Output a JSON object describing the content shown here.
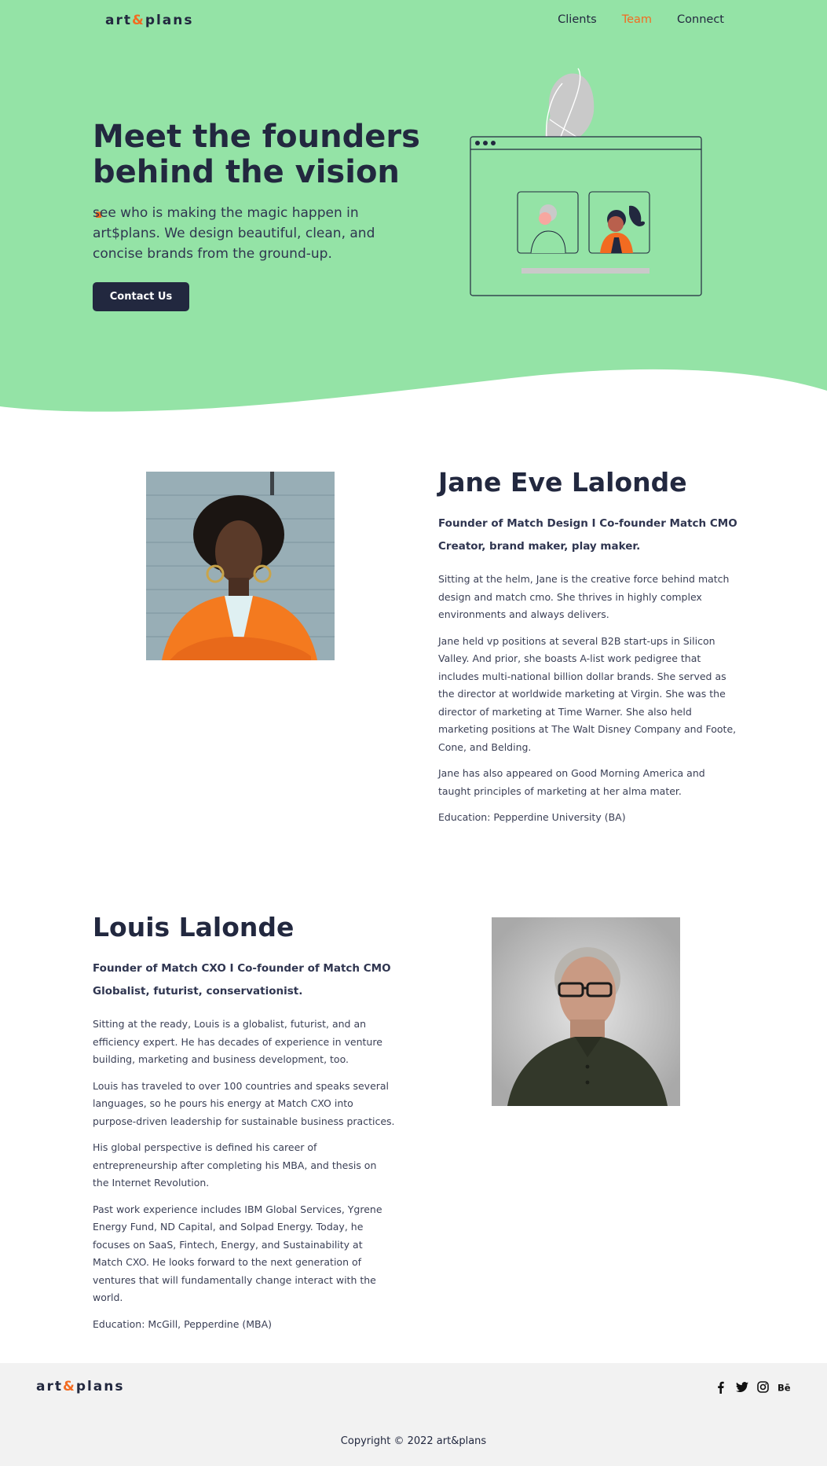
{
  "colors": {
    "hero_bg": "#94e3a6",
    "accent": "#f26b21",
    "navy": "#22283f",
    "footer_bg": "#f2f2f2"
  },
  "brand": {
    "name_start": "art",
    "amp": "&",
    "name_end": "plans"
  },
  "nav": {
    "items": [
      "Clients",
      "Team",
      "Connect"
    ],
    "active": "Team"
  },
  "hero": {
    "title_line1": "Meet the founders",
    "title_line2": "behind the vision",
    "title_dot": ".",
    "subtitle": "see who is making the magic happen in art$plans. We design beautiful, clean, and concise brands from the ground-up.",
    "cta_label": "Contact Us"
  },
  "founders": [
    {
      "name": "Jane Eve Lalonde",
      "role_line1": "Founder of Match Design I Co-founder Match CMO",
      "role_line2": "Creator, brand maker, play maker.",
      "paragraphs": [
        "Sitting at the helm, Jane is the creative force behind match design and match cmo. She thrives in highly complex environments and always delivers.",
        "Jane held vp positions at several B2B start-ups in Silicon Valley. And prior, she boasts A-list work pedigree that includes multi-national billion dollar brands. She served as the director at worldwide marketing at Virgin. She was the director of marketing at Time Warner. She also held marketing positions at The Walt Disney Company and Foote, Cone, and Belding.",
        "Jane has also appeared on Good Morning America and taught principles of marketing at her alma mater.",
        "Education: Pepperdine University (BA)"
      ]
    },
    {
      "name": "Louis Lalonde",
      "role_line1": "Founder of Match CXO I Co-founder of Match CMO",
      "role_line2": "Globalist, futurist, conservationist.",
      "paragraphs": [
        "Sitting at the ready, Louis is a globalist, futurist, and an efficiency expert. He has decades of experience in venture building, marketing and business development, too.",
        "Louis has traveled to over 100 countries and speaks several languages, so he pours his energy at Match CXO into purpose-driven leadership for sustainable business practices.",
        "His global perspective is defined his career of entrepreneurship after completing his MBA, and thesis on the Internet Revolution.",
        "Past work experience includes IBM Global Services, Ygrene Energy Fund, ND Capital, and Solpad Energy. Today, he focuses on SaaS, Fintech, Energy, and Sustainability at Match CXO. He looks forward to the next generation of ventures that will fundamentally change interact with the world.",
        "Education: McGill, Pepperdine (MBA)"
      ]
    }
  ],
  "footer": {
    "socials": [
      {
        "icon": "facebook-icon",
        "glyph": "f"
      },
      {
        "icon": "twitter-icon",
        "glyph": "t"
      },
      {
        "icon": "instagram-icon",
        "glyph": "ig"
      },
      {
        "icon": "behance-icon",
        "glyph": "Bē"
      }
    ],
    "copyright": "Copyright © 2022 art&plans"
  }
}
